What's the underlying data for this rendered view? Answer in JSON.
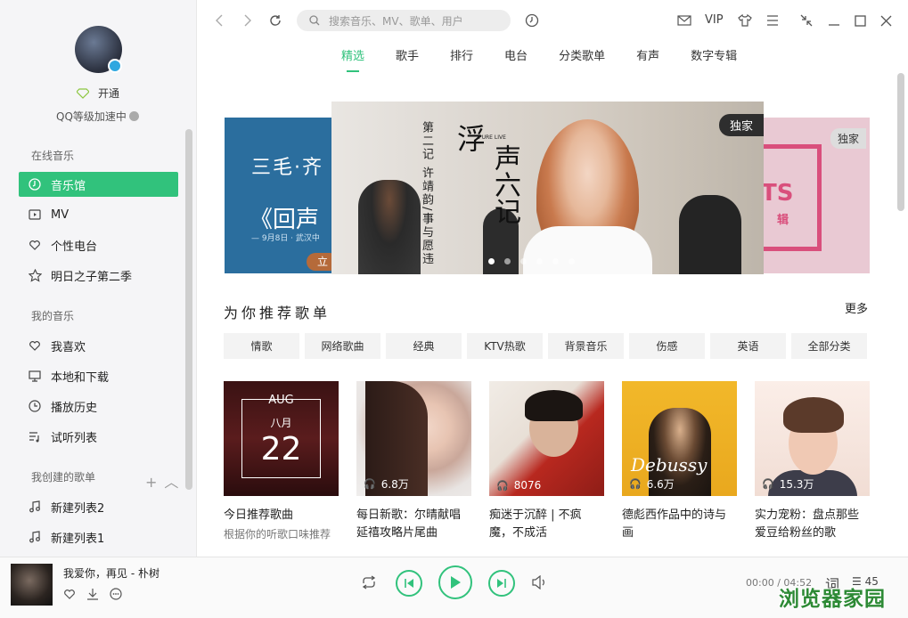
{
  "sidebar": {
    "vip_label": "开通",
    "level_label": "QQ等级加速中",
    "sections": {
      "online": "在线音乐",
      "mine": "我的音乐",
      "created": "我创建的歌单"
    },
    "online_items": [
      "音乐馆",
      "MV",
      "个性电台",
      "明日之子第二季"
    ],
    "mine_items": [
      "我喜欢",
      "本地和下载",
      "播放历史",
      "试听列表"
    ],
    "created_items": [
      "新建列表2",
      "新建列表1"
    ],
    "active_item": "音乐馆"
  },
  "topbar": {
    "search_placeholder": "搜索音乐、MV、歌单、用户",
    "vip_label": "VIP",
    "tabs": [
      "精选",
      "歌手",
      "排行",
      "电台",
      "分类歌单",
      "有声",
      "数字专辑"
    ],
    "active_tab": "精选"
  },
  "banner": {
    "left_title": "三毛·齐",
    "left_subtitle": "《回声",
    "left_date": "— 9月8日 · 武汉中",
    "left_button": "立",
    "main_side_text": "第二记 许靖韵/事与愿违",
    "main_big_text_1": "浮",
    "main_big_text_2": "声六记",
    "main_pure_live": "PURE LIVE",
    "main_tag": "独家",
    "right_tag": "独家",
    "right_text": "TS",
    "right_sub": "辑",
    "dot_count": 6,
    "active_dot": 0
  },
  "recommend": {
    "title": "为你推荐歌单",
    "more": "更多",
    "categories": [
      "情歌",
      "网络歌曲",
      "经典",
      "KTV热歌",
      "背景音乐",
      "伤感",
      "英语",
      "全部分类"
    ],
    "cards": [
      {
        "title": "今日推荐歌曲",
        "subtitle": "根据你的听歌口味推荐",
        "plays": "",
        "cover_month": "AUG",
        "cover_cn_month": "八月",
        "cover_day": "22"
      },
      {
        "title": "每日新歌：尔晴献唱延禧攻略片尾曲",
        "subtitle": "",
        "plays": "6.8万"
      },
      {
        "title": "痴迷于沉醉 | 不疯魔，不成活",
        "subtitle": "",
        "plays": "8076"
      },
      {
        "title": "德彪西作品中的诗与画",
        "subtitle": "",
        "plays": "6.6万",
        "cover_text": "Debussy"
      },
      {
        "title": "实力宠粉：盘点那些爱豆给粉丝的歌",
        "subtitle": "",
        "plays": "15.3万"
      }
    ]
  },
  "player": {
    "song": "我爱你，再见 - 朴树",
    "time": "00:00 / 04:52",
    "lyric_label": "词",
    "queue_count": "45"
  },
  "watermark": "浏览器家园",
  "colors": {
    "accent": "#31c27c"
  }
}
